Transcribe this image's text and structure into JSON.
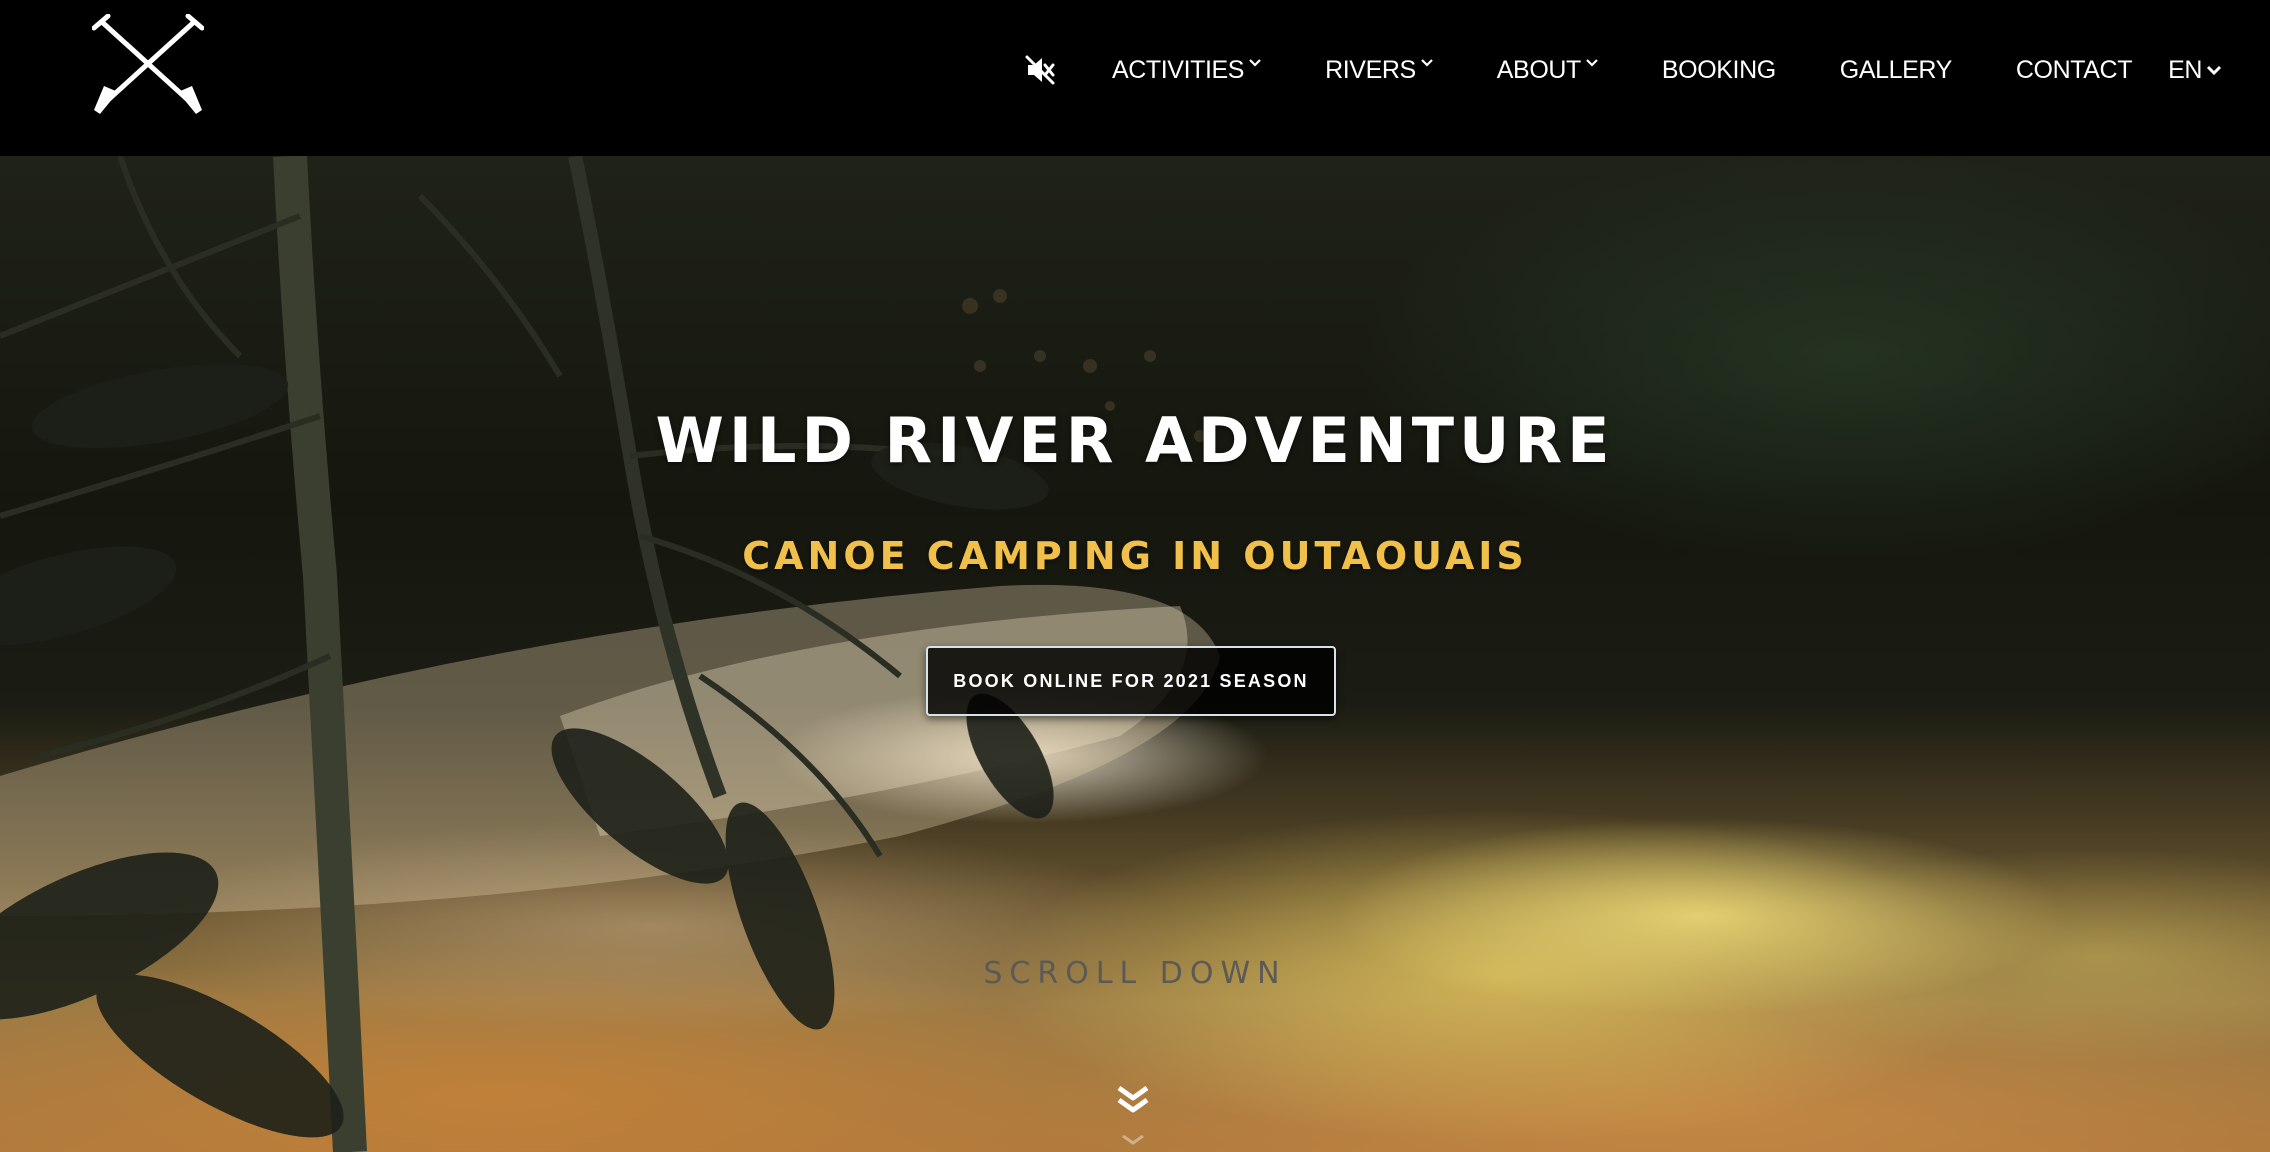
{
  "nav": {
    "logo": "crossed-paddles-logo",
    "mute_icon": "speaker-mute-icon",
    "items": [
      {
        "label": "ACTIVITIES",
        "dropdown": true
      },
      {
        "label": "RIVERS",
        "dropdown": true
      },
      {
        "label": "ABOUT",
        "dropdown": true
      },
      {
        "label": "BOOKING",
        "dropdown": false
      },
      {
        "label": "GALLERY",
        "dropdown": false
      },
      {
        "label": "CONTACT",
        "dropdown": false
      }
    ],
    "language": "EN"
  },
  "hero": {
    "title": "WILD RIVER ADVENTURE",
    "subtitle": "CANOE CAMPING IN OUTAOUAIS",
    "cta_label": "BOOK ONLINE FOR 2021 SEASON",
    "scroll_label": "SCROLL DOWN",
    "scroll_icon": "double-chevron-down-icon"
  },
  "colors": {
    "nav_background": "#000000",
    "subtitle_accent": "#f1c04a",
    "title_text": "#ffffff"
  }
}
